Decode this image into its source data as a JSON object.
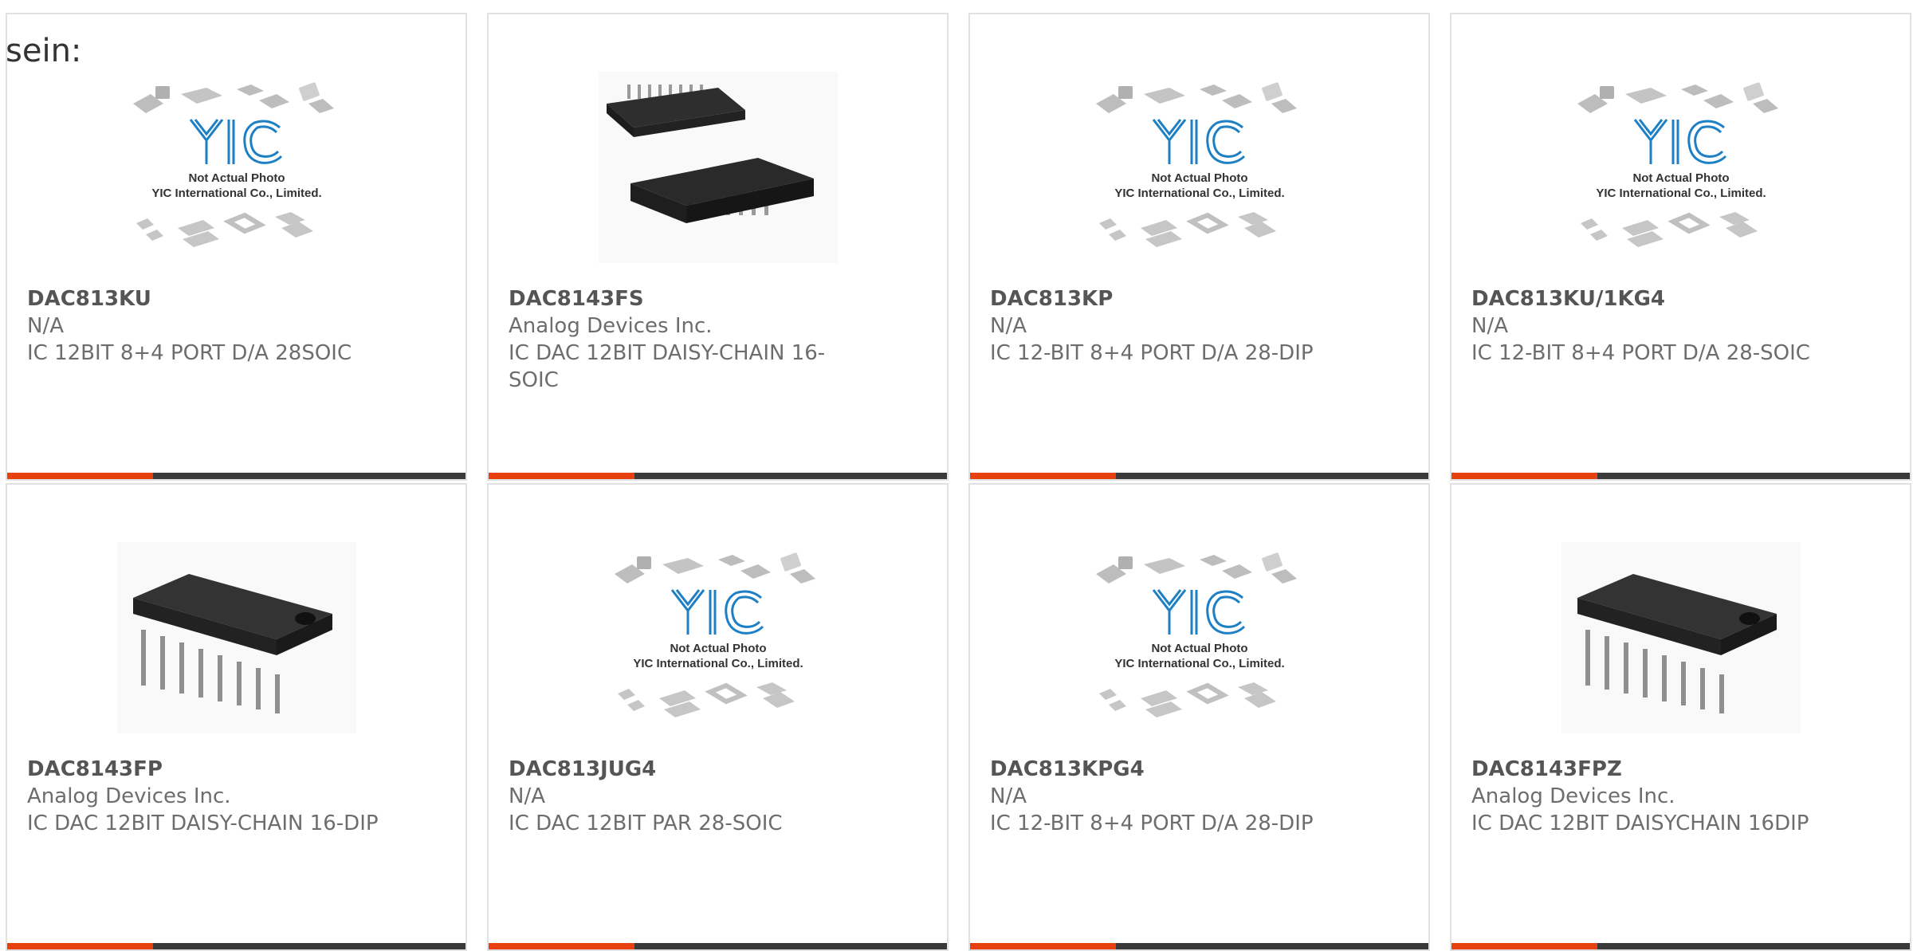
{
  "intro_text": "sein:",
  "placeholder": {
    "logo": "YIC",
    "line1": "Not Actual Photo",
    "line2": "YIC International Co., Limited."
  },
  "colors": {
    "accent": "#e8410f",
    "bar": "#3a3a3a",
    "border": "#e1e1e1",
    "logo_blue": "#1d7fc4"
  },
  "products": [
    {
      "part": "DAC813KU",
      "maker": "N/A",
      "desc": "IC 12BIT 8+4 PORT D/A 28SOIC",
      "image": "placeholder-photo"
    },
    {
      "part": "DAC8143FS",
      "maker": "Analog Devices Inc.",
      "desc": "IC DAC 12BIT DAISY-CHAIN 16-SOIC",
      "image": "soic-chip-photo"
    },
    {
      "part": "DAC813KP",
      "maker": "N/A",
      "desc": "IC 12-BIT 8+4 PORT D/A 28-DIP",
      "image": "placeholder-photo"
    },
    {
      "part": "DAC813KU/1KG4",
      "maker": "N/A",
      "desc": "IC 12-BIT 8+4 PORT D/A 28-SOIC",
      "image": "placeholder-photo"
    },
    {
      "part": "DAC8143FP",
      "maker": "Analog Devices Inc.",
      "desc": "IC DAC 12BIT DAISY-CHAIN 16-DIP",
      "image": "dip-chip-photo"
    },
    {
      "part": "DAC813JUG4",
      "maker": "N/A",
      "desc": "IC DAC 12BIT PAR 28-SOIC",
      "image": "placeholder-photo"
    },
    {
      "part": "DAC813KPG4",
      "maker": "N/A",
      "desc": "IC 12-BIT 8+4 PORT D/A 28-DIP",
      "image": "placeholder-photo"
    },
    {
      "part": "DAC8143FPZ",
      "maker": "Analog Devices Inc.",
      "desc": "IC DAC 12BIT DAISYCHAIN 16DIP",
      "image": "dip-chip-photo"
    }
  ]
}
